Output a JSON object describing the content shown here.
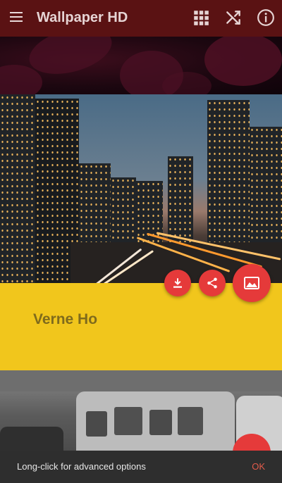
{
  "app": {
    "title": "Wallpaper HD"
  },
  "toolbar": {
    "actions": [
      {
        "icon": "grid-icon"
      },
      {
        "icon": "shuffle-icon"
      },
      {
        "icon": "info-icon"
      }
    ]
  },
  "featured": {
    "author": "Verne Ho",
    "actions": [
      {
        "icon": "download-icon"
      },
      {
        "icon": "share-icon"
      },
      {
        "icon": "image-icon"
      }
    ]
  },
  "snackbar": {
    "message": "Long-click for advanced options",
    "action": "OK"
  },
  "colors": {
    "appbar": "#5a1213",
    "credit_band": "#f1c61c",
    "fab": "#e53a3a",
    "snackbar": "#2e2e2e",
    "snackbar_action": "#e25b4b"
  }
}
